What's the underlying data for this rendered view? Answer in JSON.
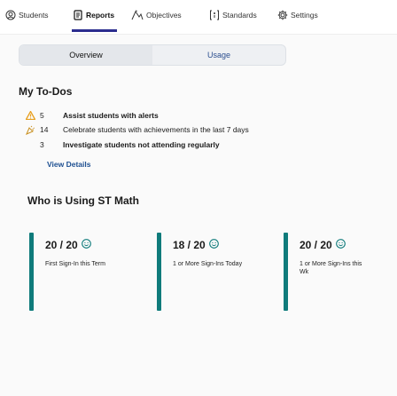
{
  "nav": {
    "items": [
      {
        "label": "Students",
        "icon": "people-icon"
      },
      {
        "label": "Reports",
        "icon": "reports-icon",
        "active": true
      },
      {
        "label": "Objectives",
        "icon": "objectives-icon"
      },
      {
        "label": "Standards",
        "icon": "standards-icon"
      },
      {
        "label": "Settings",
        "icon": "gear-icon"
      }
    ]
  },
  "tabs": {
    "overview": "Overview",
    "usage": "Usage"
  },
  "todos": {
    "title": "My To-Dos",
    "items": [
      {
        "count": "5",
        "text": "Assist students with alerts",
        "icon": "alert-icon",
        "bold_all": true
      },
      {
        "count": "14",
        "text_normal": "Celebrate students with achievements in the last 7 days",
        "icon": "celebrate-icon"
      },
      {
        "count": "3",
        "text_bold": "Investigate students not attending regularly",
        "icon": "none"
      }
    ],
    "view_details": "View Details"
  },
  "usage": {
    "title": "Who is Using ST Math",
    "cards": [
      {
        "count": "20 / 20",
        "label": "First Sign-In this Term",
        "icon": "smiley-icon"
      },
      {
        "count": "18 / 20",
        "label": "1 or More Sign-Ins Today",
        "icon": "smiley-icon"
      },
      {
        "count": "20 / 20",
        "label": "1 or More Sign-Ins this Wk",
        "icon": "smiley-icon"
      }
    ]
  },
  "colors": {
    "accent": "#2b2d8e",
    "teal": "#0f7b7b",
    "link": "#1d4f91",
    "alert": "#e8a020"
  }
}
